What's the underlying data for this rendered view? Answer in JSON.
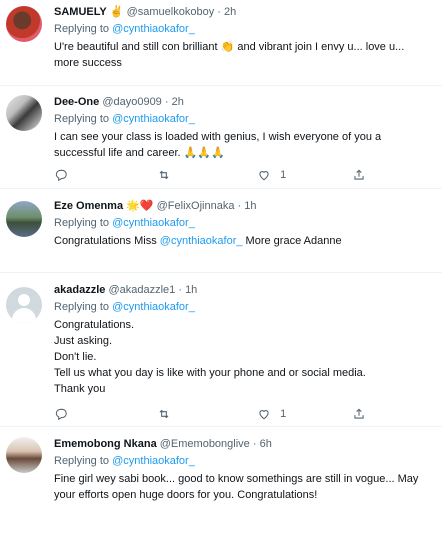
{
  "tweets": [
    {
      "name": "SAMUELY",
      "name_emoji": "✌️",
      "handle": "@samuelkokoboy",
      "dot": "·",
      "time": "2h",
      "replying_prefix": "Replying to",
      "replying_handle": "@cynthiaokafor_",
      "text_parts": [
        "U're beautiful and still con brilliant ",
        "👏",
        " and vibrant join  I envy u... love u...",
        "more success"
      ],
      "like_count": ""
    },
    {
      "name": "Dee-One",
      "handle": "@dayo0909",
      "dot": "·",
      "time": "2h",
      "replying_prefix": "Replying to",
      "replying_handle": "@cynthiaokafor_",
      "text_line1": "I can see your class is loaded with genius, I wish everyone of you a",
      "text_line2": "successful life and career. ",
      "text_emoji": "🙏🙏🙏",
      "like_count": "1"
    },
    {
      "name": "Eze Omenma",
      "name_emoji": "🌟❤️",
      "handle": "@FelixOjinnaka",
      "dot": "·",
      "time": "1h",
      "replying_prefix": "Replying to",
      "replying_handle": "@cynthiaokafor_",
      "text_prefix": "Congratulations Miss ",
      "text_mention": "@cynthiaokafor_",
      "text_suffix": " More grace Adanne",
      "like_count": ""
    },
    {
      "name": "akadazzle",
      "handle": "@akadazzle1",
      "dot": "·",
      "time": "1h",
      "replying_prefix": "Replying to",
      "replying_handle": "@cynthiaokafor_",
      "lines": [
        "Congratulations.",
        "Just asking.",
        "Don't lie.",
        "Tell us what you day is like with your phone and or social media.",
        "Thank you"
      ],
      "like_count": "1"
    },
    {
      "name": "Ememobong Nkana",
      "handle": "@Ememobonglive",
      "dot": "·",
      "time": "6h",
      "replying_prefix": "Replying to",
      "replying_handle": "@cynthiaokafor_",
      "text_line1": "Fine girl wey sabi book... good to know somethings are still in vogue... May",
      "text_line2": "your efforts open huge doors for you. Congratulations!",
      "like_count": ""
    }
  ],
  "icons": {
    "reply": "reply-icon",
    "retweet": "retweet-icon",
    "like": "heart-icon",
    "share": "share-icon"
  },
  "colors": {
    "link": "#1d9bf0",
    "muted": "#536471",
    "text": "#0f1419",
    "divider": "#eff3f4"
  }
}
